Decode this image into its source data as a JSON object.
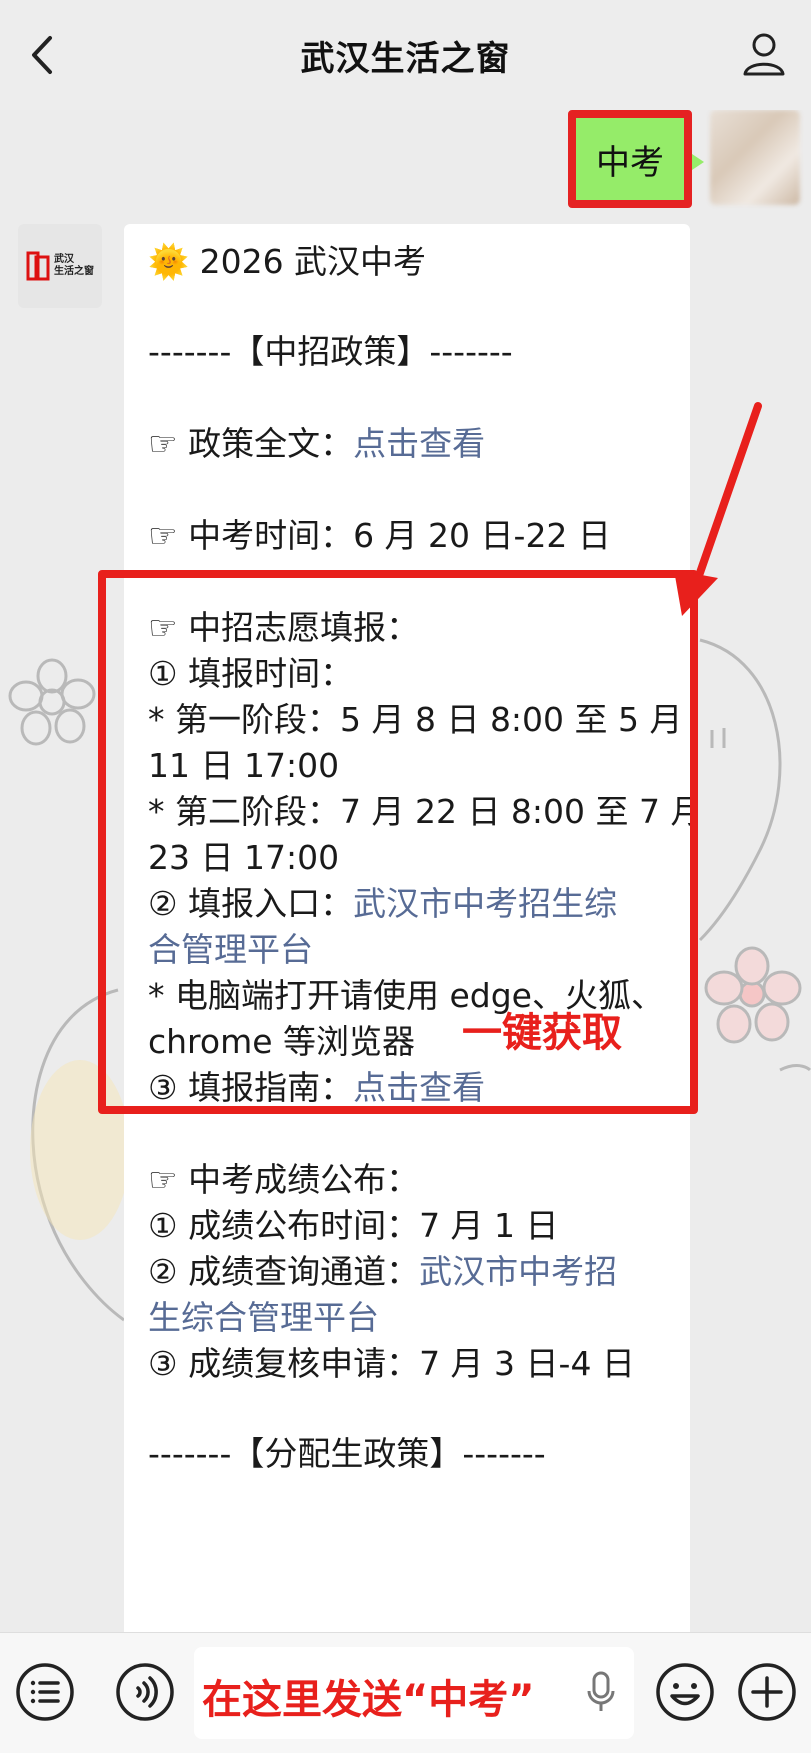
{
  "header": {
    "title": "武汉生活之窗"
  },
  "user_message": {
    "text": "中考"
  },
  "bot": {
    "logo_line1": "武汉",
    "logo_line2": "生活之窗",
    "lines": [
      {
        "text": "🌞 2026 武汉中考"
      },
      {
        "text": "-------【中招政策】-------"
      },
      {
        "prefix": "☞ 政策全文：",
        "link": "点击查看"
      },
      {
        "text": "☞ 中考时间：6 月 20 日-22 日"
      },
      {
        "text": "☞ 中招志愿填报："
      },
      {
        "text": "① 填报时间："
      },
      {
        "text": "* 第一阶段：5 月 8 日 8:00 至 5 月"
      },
      {
        "text": "11 日 17:00"
      },
      {
        "text": "* 第二阶段：7 月 22 日 8:00 至 7 月"
      },
      {
        "text": "23 日 17:00"
      },
      {
        "prefix": "② 填报入口：",
        "link": "武汉市中考招生综"
      },
      {
        "link": "合管理平台"
      },
      {
        "text": "* 电脑端打开请使用 edge、火狐、"
      },
      {
        "text": "chrome 等浏览器"
      },
      {
        "prefix": "③ 填报指南：",
        "link": "点击查看"
      },
      {
        "text": "☞ 中考成绩公布："
      },
      {
        "text": "① 成绩公布时间：7 月 1 日"
      },
      {
        "prefix": "② 成绩查询通道：",
        "link": "武汉市中考招"
      },
      {
        "link": "生综合管理平台"
      },
      {
        "text": "③ 成绩复核申请：7 月 3 日-4 日"
      },
      {
        "text": "-------【分配生政策】-------"
      }
    ]
  },
  "annotation": {
    "one_click": "一键获取"
  },
  "input": {
    "hint": "在这里发送“中考”"
  },
  "colors": {
    "accent_red": "#e8201c",
    "bubble_green": "#95ec69",
    "link_blue": "#576b95"
  }
}
